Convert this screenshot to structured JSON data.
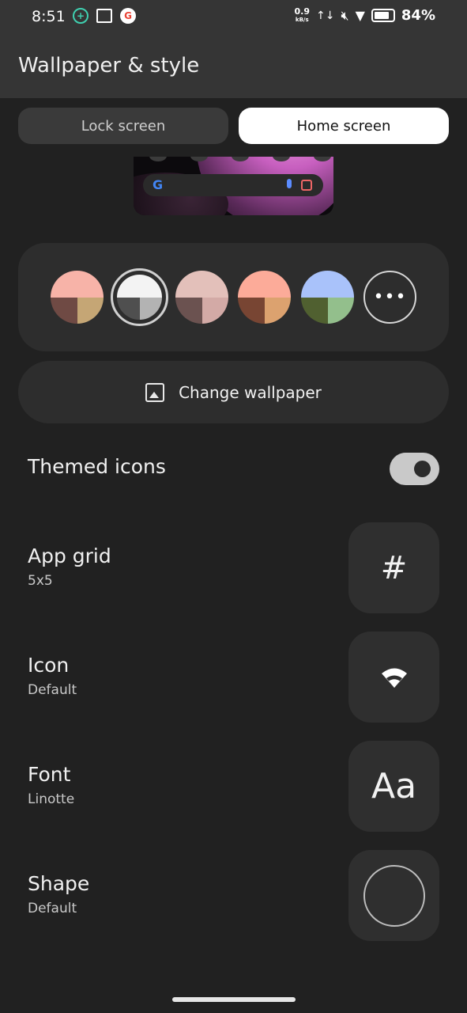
{
  "status_bar": {
    "time": "8:51",
    "speed_value": "0.9",
    "speed_unit": "kB/s",
    "battery": "84%"
  },
  "app_bar": {
    "title": "Wallpaper & style"
  },
  "tabs": [
    {
      "label": "Lock screen",
      "selected": false
    },
    {
      "label": "Home screen",
      "selected": true
    }
  ],
  "colors": {
    "swatches": [
      {
        "top": "#f7b3a8",
        "bl": "#6f4a44",
        "br": "#c5a675",
        "selected": false
      },
      {
        "top": "#f3f3f3",
        "bl": "#4f4f4f",
        "br": "#b3b3b3",
        "selected": true
      },
      {
        "top": "#e3c0ba",
        "bl": "#6b5250",
        "br": "#d3aaa6",
        "selected": false
      },
      {
        "top": "#fcab99",
        "bl": "#784533",
        "br": "#dca26f",
        "selected": false
      },
      {
        "top": "#a9c2fa",
        "bl": "#506030",
        "br": "#93bf8c",
        "selected": false
      }
    ],
    "more_label": "•••"
  },
  "change_wallpaper": {
    "label": "Change wallpaper",
    "icon": "wallpaper-icon"
  },
  "themed_icons": {
    "label": "Themed icons",
    "enabled": true
  },
  "options": [
    {
      "id": "app-grid",
      "label": "App grid",
      "value": "5x5",
      "tile": "#"
    },
    {
      "id": "icon",
      "label": "Icon",
      "value": "Default",
      "tile": "wifi-icon"
    },
    {
      "id": "font",
      "label": "Font",
      "value": "Linotte",
      "tile": "Aa"
    },
    {
      "id": "shape",
      "label": "Shape",
      "value": "Default",
      "tile": "circle-shape"
    }
  ]
}
